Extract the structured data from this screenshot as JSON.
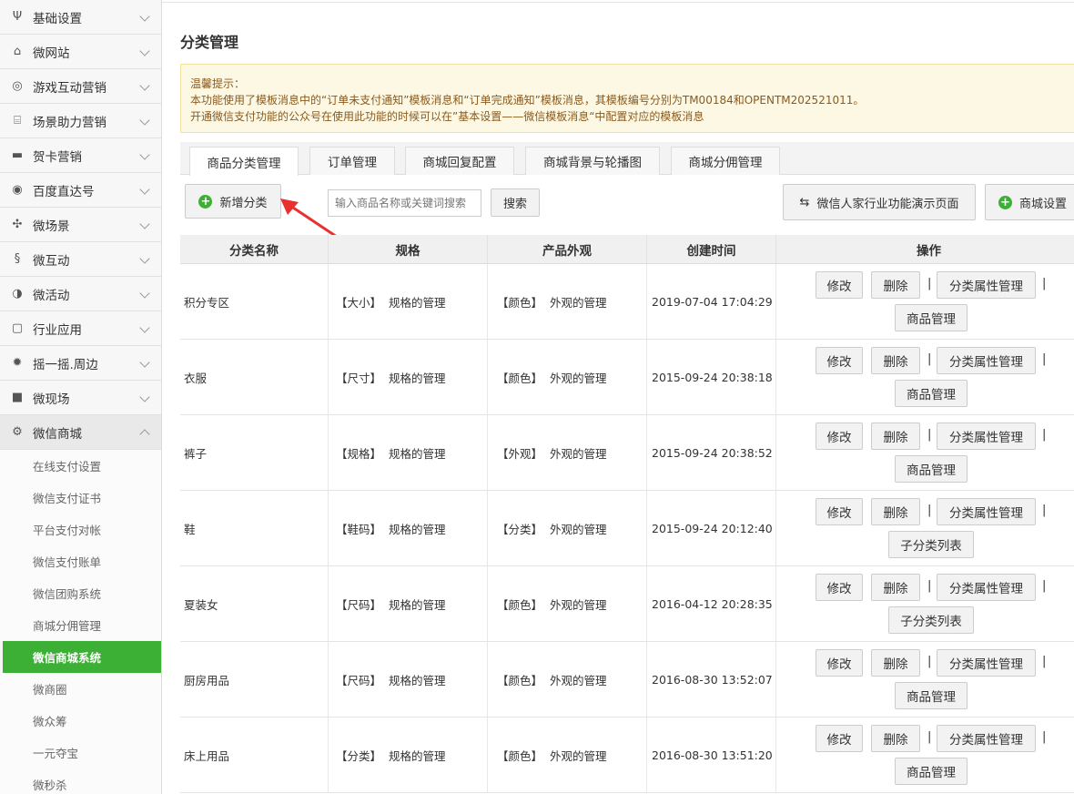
{
  "sidebar": {
    "items": [
      {
        "label": "基础设置",
        "icon": "fork-knife-icon"
      },
      {
        "label": "微网站",
        "icon": "home-icon"
      },
      {
        "label": "游戏互动营销",
        "icon": "gamepad-icon"
      },
      {
        "label": "场景助力营销",
        "icon": "bank-icon"
      },
      {
        "label": "贺卡营销",
        "icon": "card-icon"
      },
      {
        "label": "百度直达号",
        "icon": "baidu-icon"
      },
      {
        "label": "微场景",
        "icon": "scene-icon"
      },
      {
        "label": "微互动",
        "icon": "interaction-icon"
      },
      {
        "label": "微活动",
        "icon": "activity-icon"
      },
      {
        "label": "行业应用",
        "icon": "app-icon"
      },
      {
        "label": "摇一摇.周边",
        "icon": "shake-icon"
      },
      {
        "label": "微现场",
        "icon": "video-icon"
      },
      {
        "label": "微信商城",
        "icon": "gear-icon"
      }
    ],
    "sub_items": [
      "在线支付设置",
      "微信支付证书",
      "平台支付对帐",
      "微信支付账单",
      "微信团购系统",
      "商城分佣管理",
      "微信商城系统",
      "微商圈",
      "微众筹",
      "一元夺宝",
      "微秒杀"
    ],
    "active_sub": "微信商城系统"
  },
  "page": {
    "title": "分类管理",
    "notice": {
      "line1": "温馨提示：",
      "line2": "本功能使用了模板消息中的“订单未支付通知”模板消息和“订单完成通知”模板消息，其模板编号分别为TM00184和OPENTM202521011。",
      "line3": "开通微信支付功能的公众号在使用此功能的时候可以在”基本设置——微信模板消息“中配置对应的模板消息"
    }
  },
  "tabs": [
    "商品分类管理",
    "订单管理",
    "商城回复配置",
    "商城背景与轮播图",
    "商城分佣管理"
  ],
  "toolbar": {
    "add_label": "新增分类",
    "search_placeholder": "输入商品名称或关键词搜索",
    "search_label": "搜索",
    "demo_label": "微信人家行业功能演示页面",
    "settings_label": "商城设置"
  },
  "table": {
    "headers": [
      "分类名称",
      "规格",
      "产品外观",
      "创建时间",
      "操作"
    ],
    "rows": [
      {
        "name": "积分专区",
        "spec": "【大小】  规格的管理",
        "look": "【颜色】  外观的管理",
        "time": "2019-07-04 17:04:29",
        "extra": "商品管理"
      },
      {
        "name": "衣服",
        "spec": "【尺寸】  规格的管理",
        "look": "【颜色】  外观的管理",
        "time": "2015-09-24 20:38:18",
        "extra": "商品管理"
      },
      {
        "name": "裤子",
        "spec": "【规格】  规格的管理",
        "look": "【外观】  外观的管理",
        "time": "2015-09-24 20:38:52",
        "extra": "商品管理"
      },
      {
        "name": "鞋",
        "spec": "【鞋码】  规格的管理",
        "look": "【分类】  外观的管理",
        "time": "2015-09-24 20:12:40",
        "extra": "子分类列表"
      },
      {
        "name": "夏装女",
        "spec": "【尺码】  规格的管理",
        "look": "【颜色】  外观的管理",
        "time": "2016-04-12 20:28:35",
        "extra": "子分类列表"
      },
      {
        "name": "厨房用品",
        "spec": "【尺码】  规格的管理",
        "look": "【颜色】  外观的管理",
        "time": "2016-08-30 13:52:07",
        "extra": "商品管理"
      },
      {
        "name": "床上用品",
        "spec": "【分类】  规格的管理",
        "look": "【颜色】  外观的管理",
        "time": "2016-08-30 13:51:20",
        "extra": "商品管理"
      }
    ],
    "ops": {
      "edit": "修改",
      "delete": "删除",
      "attr": "分类属性管理",
      "sep": "|"
    }
  },
  "colors": {
    "accent": "#3cb034",
    "notice_bg": "#fcf8e3",
    "notice_text": "#8a5a1f",
    "arrow": "#e8312f"
  }
}
